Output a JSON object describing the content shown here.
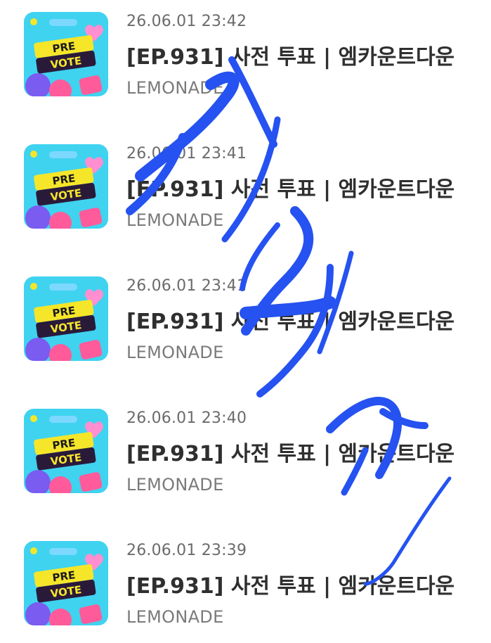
{
  "colors": {
    "scribble": "#2552f0",
    "thumb_bg": "#3fd3f0",
    "thumb_yellow": "#f6e62a",
    "thumb_pink": "#ff5b9a",
    "thumb_purple": "#7a5cf0"
  },
  "items": [
    {
      "timestamp": "26.06.01 23:42",
      "title": "[EP.931] 사전 투표 | 엠카운트다운",
      "artist": "LEMONADE",
      "thumb_line1": "PRE",
      "thumb_line2": "VOTE"
    },
    {
      "timestamp": "26.06.01 23:41",
      "title": "[EP.931] 사전 투표 | 엠카운트다운",
      "artist": "LEMONADE",
      "thumb_line1": "PRE",
      "thumb_line2": "VOTE"
    },
    {
      "timestamp": "26.06.01 23:41",
      "title": "[EP.931] 사전 투표 | 엠카운트다운",
      "artist": "LEMONADE",
      "thumb_line1": "PRE",
      "thumb_line2": "VOTE"
    },
    {
      "timestamp": "26.06.01 23:40",
      "title": "[EP.931] 사전 투표 | 엠카운트다운",
      "artist": "LEMONADE",
      "thumb_line1": "PRE",
      "thumb_line2": "VOTE"
    },
    {
      "timestamp": "26.06.01 23:39",
      "title": "[EP.931] 사전 투표 | 엠카운트다운",
      "artist": "LEMONADE",
      "thumb_line1": "PRE",
      "thumb_line2": "VOTE"
    }
  ]
}
